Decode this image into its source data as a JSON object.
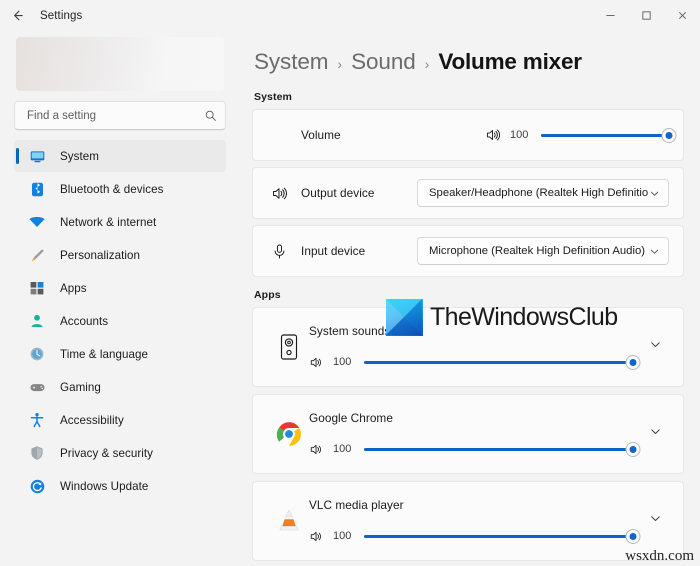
{
  "titlebar": {
    "back_label": "Back",
    "title": "Settings",
    "minimize": "–",
    "maximize": "▫",
    "close": "✕"
  },
  "sidebar": {
    "search": {
      "placeholder": "Find a setting",
      "value": "",
      "icon": "search-icon"
    },
    "items": [
      {
        "label": "System",
        "icon": "monitor-icon",
        "selected": true
      },
      {
        "label": "Bluetooth & devices",
        "icon": "bluetooth-icon",
        "selected": false
      },
      {
        "label": "Network & internet",
        "icon": "wifi-icon",
        "selected": false
      },
      {
        "label": "Personalization",
        "icon": "paintbrush-icon",
        "selected": false
      },
      {
        "label": "Apps",
        "icon": "apps-grid-icon",
        "selected": false
      },
      {
        "label": "Accounts",
        "icon": "person-icon",
        "selected": false
      },
      {
        "label": "Time & language",
        "icon": "clock-globe-icon",
        "selected": false
      },
      {
        "label": "Gaming",
        "icon": "gamepad-icon",
        "selected": false
      },
      {
        "label": "Accessibility",
        "icon": "accessibility-icon",
        "selected": false
      },
      {
        "label": "Privacy & security",
        "icon": "shield-icon",
        "selected": false
      },
      {
        "label": "Windows Update",
        "icon": "update-icon",
        "selected": false
      }
    ]
  },
  "breadcrumb": {
    "root": "System",
    "parent": "Sound",
    "current": "Volume mixer",
    "separator": "›"
  },
  "system_section": {
    "label": "System",
    "volume_row": {
      "label": "Volume",
      "icon": "speaker-icon",
      "value": "100",
      "percent": 100
    },
    "output_row": {
      "label": "Output device",
      "icon": "speaker-icon",
      "selected": "Speaker/Headphone (Realtek High Definitio",
      "caret": "chevron-down-icon"
    },
    "input_row": {
      "label": "Input device",
      "icon": "microphone-icon",
      "selected": "Microphone (Realtek High Definition Audio)",
      "caret": "chevron-down-icon"
    }
  },
  "apps_section": {
    "label": "Apps",
    "apps": [
      {
        "name": "System sounds",
        "icon": "system-sounds-speaker-icon",
        "volume_icon": "speaker-icon",
        "value": "100",
        "percent": 100,
        "expand_icon": "chevron-down-icon"
      },
      {
        "name": "Google Chrome",
        "icon": "chrome-icon",
        "volume_icon": "speaker-icon",
        "value": "100",
        "percent": 100,
        "expand_icon": "chevron-down-icon"
      },
      {
        "name": "VLC media player",
        "icon": "vlc-cone-icon",
        "volume_icon": "speaker-icon",
        "value": "100",
        "percent": 100,
        "expand_icon": "chevron-down-icon"
      }
    ]
  },
  "watermarks": {
    "brand": "TheWindowsClub",
    "corner": "wsxdn.com"
  },
  "colors": {
    "accent": "#0067c0",
    "slider_fill": "#0f62c7",
    "window_bg": "#f3f3f3",
    "card_bg": "#fbfbfb"
  }
}
